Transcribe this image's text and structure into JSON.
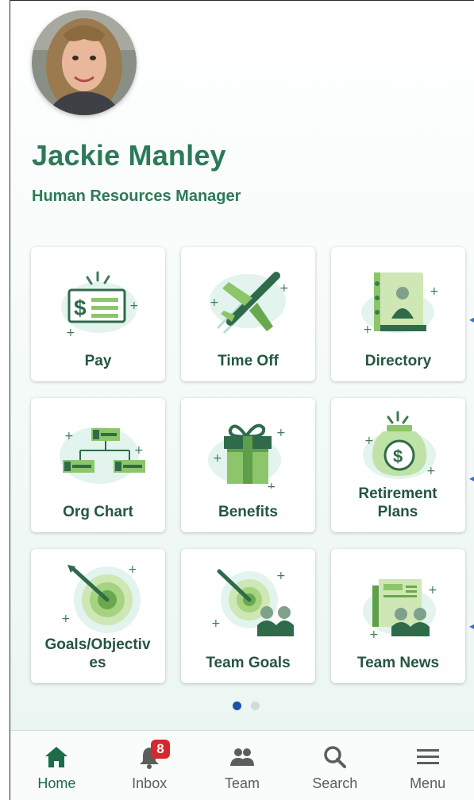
{
  "profile": {
    "name": "Jackie Manley",
    "title": "Human Resources Manager"
  },
  "tiles": [
    {
      "label": "Pay",
      "icon": "pay-check-icon"
    },
    {
      "label": "Time Off",
      "icon": "airplane-icon"
    },
    {
      "label": "Directory",
      "icon": "directory-book-icon"
    },
    {
      "label": "Org Chart",
      "icon": "org-chart-icon"
    },
    {
      "label": "Benefits",
      "icon": "gift-box-icon"
    },
    {
      "label": "Retirement Plans",
      "icon": "savings-jar-icon"
    },
    {
      "label": "Goals/Objectives",
      "icon": "target-arrow-icon"
    },
    {
      "label": "Team Goals",
      "icon": "team-target-icon"
    },
    {
      "label": "Team News",
      "icon": "team-news-icon"
    }
  ],
  "pager": {
    "pages": 2,
    "current": 1
  },
  "tabbar": {
    "items": [
      {
        "label": "Home",
        "icon": "home-icon",
        "active": true
      },
      {
        "label": "Inbox",
        "icon": "bell-icon",
        "badge": "8"
      },
      {
        "label": "Team",
        "icon": "team-icon"
      },
      {
        "label": "Search",
        "icon": "search-icon"
      },
      {
        "label": "Menu",
        "icon": "hamburger-menu-icon"
      }
    ]
  },
  "colors": {
    "brand_green": "#2d7a58",
    "label_green": "#24563f",
    "light_green": "#8cc56a",
    "badge_red": "#d6282c",
    "pager_active": "#1f4fa8"
  }
}
